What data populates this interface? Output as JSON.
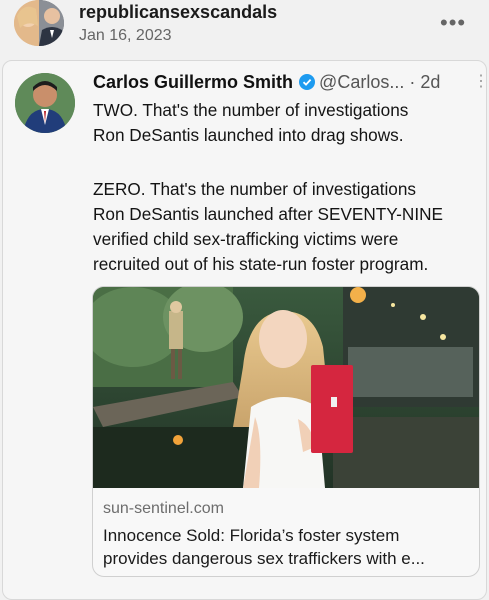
{
  "post": {
    "author": "republicansexscandals",
    "date": "Jan 16, 2023",
    "menu_icon": "more-horizontal-icon"
  },
  "tweet": {
    "name": "Carlos Guillermo Smith",
    "handle": "@Carlos...",
    "separator": "·",
    "time": "2d",
    "verified_icon": "verified-badge-icon",
    "verified_color": "#1d9bf0",
    "paragraph1": [
      "TWO. That's the number of investigations",
      "Ron DeSantis launched into drag shows."
    ],
    "paragraph2": [
      "ZERO. That's the number of investigations",
      "Ron DeSantis launched after SEVENTY-NINE",
      "verified child sex-trafficking victims were",
      "recruited out of his state-run foster program."
    ]
  },
  "link_card": {
    "domain": "sun-sentinel.com",
    "title": [
      "Innocence Sold: Florida’s foster system",
      "provides dangerous sex traffickers with e..."
    ]
  }
}
